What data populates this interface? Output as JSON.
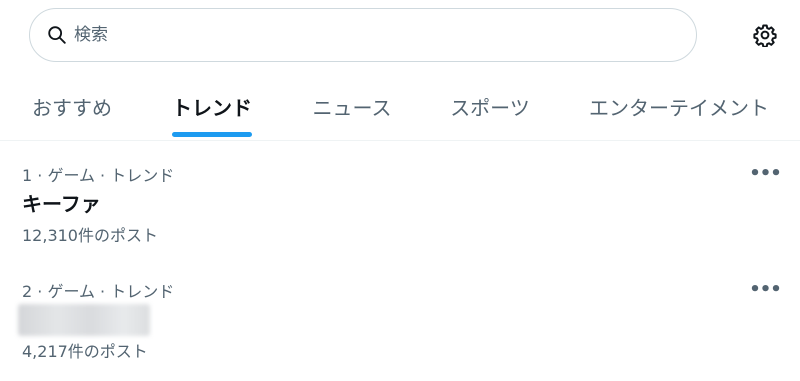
{
  "search": {
    "placeholder": "検索",
    "icon": "search-icon"
  },
  "settings": {
    "icon": "gear-icon"
  },
  "tabs": [
    {
      "label": "おすすめ",
      "active": false
    },
    {
      "label": "トレンド",
      "active": true
    },
    {
      "label": "ニュース",
      "active": false
    },
    {
      "label": "スポーツ",
      "active": false
    },
    {
      "label": "エンターテイメント",
      "active": false
    }
  ],
  "accent_color": "#1d9bf0",
  "trends": [
    {
      "meta": "1 · ゲーム · トレンド",
      "name": "キーファ",
      "count": "12,310件のポスト",
      "more": "•••"
    },
    {
      "meta": "2 · ゲーム · トレンド",
      "name_blurred": true,
      "count": "4,217件のポスト",
      "more": "•••"
    }
  ]
}
